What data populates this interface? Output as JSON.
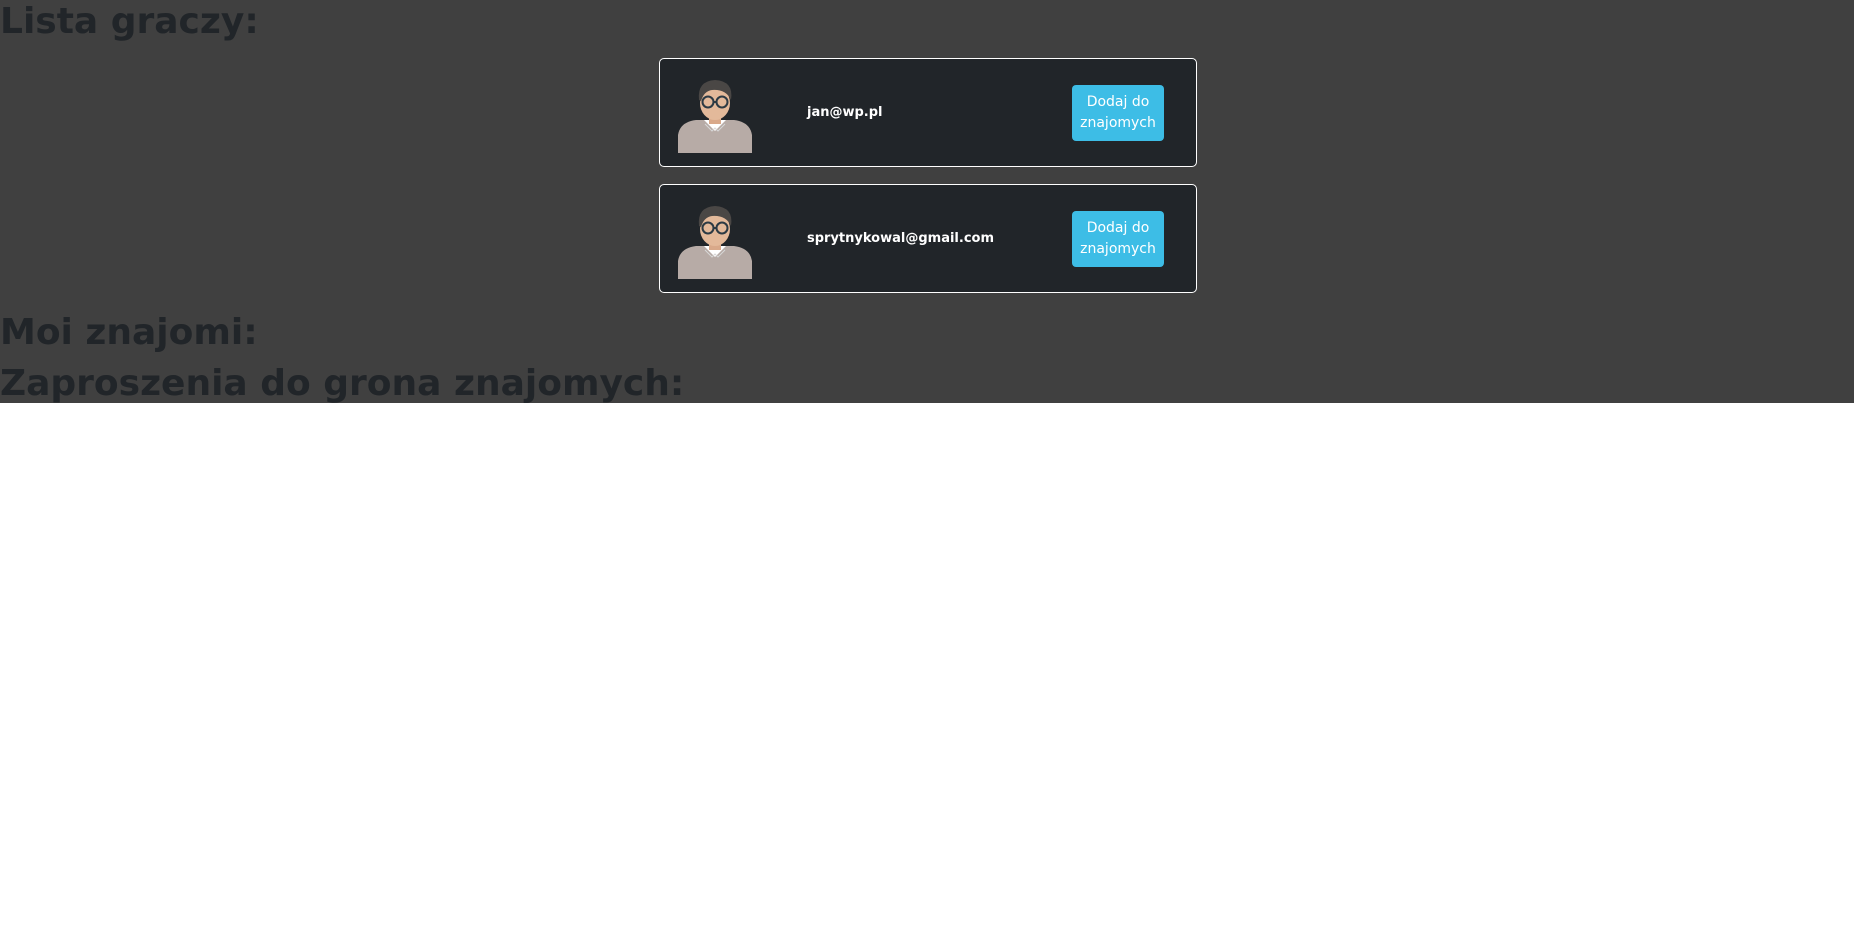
{
  "sections": {
    "players_title": "Lista graczy:",
    "friends_title": "Moi znajomi:",
    "invites_title": "Zaproszenia do grona znajomych:"
  },
  "players": [
    {
      "email": "jan@wp.pl",
      "avatar_icon": "user-avatar-icon",
      "button_label": "Dodaj do znajomych"
    },
    {
      "email": "sprytnykowal@gmail.com",
      "avatar_icon": "user-avatar-icon",
      "button_label": "Dodaj do znajomych"
    }
  ],
  "colors": {
    "page_background": "#404040",
    "card_background": "#212529",
    "card_border": "#ffffff",
    "button_background": "#3dbde6",
    "heading_text": "#212529"
  }
}
